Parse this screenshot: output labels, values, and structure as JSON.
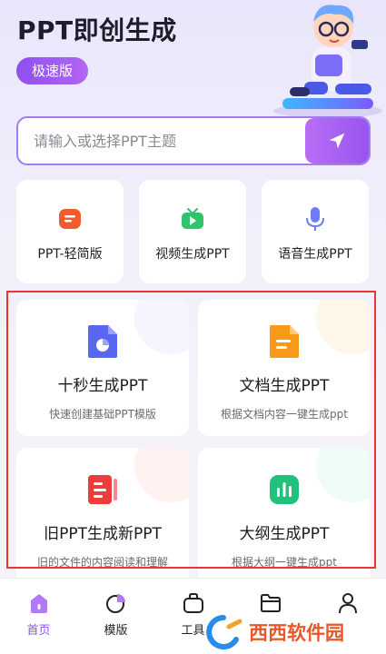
{
  "header": {
    "title": "PPT即创生成",
    "badge": "极速版"
  },
  "search": {
    "placeholder": "请输入或选择PPT主题",
    "button_icon": "send-icon"
  },
  "quick_actions": [
    {
      "label": "PPT-轻简版",
      "icon": "doc-lines-icon",
      "color": "#f05b2f"
    },
    {
      "label": "视频生成PPT",
      "icon": "tv-play-icon",
      "color": "#2fc46b"
    },
    {
      "label": "语音生成PPT",
      "icon": "microphone-icon",
      "color": "#6b7ef5"
    }
  ],
  "feature_cards": [
    {
      "title": "十秒生成PPT",
      "subtitle": "快速创建基础PPT模版",
      "icon": "pie-doc-icon",
      "color": "#5866f0"
    },
    {
      "title": "文档生成PPT",
      "subtitle": "根据文档内容一键生成ppt",
      "icon": "document-icon",
      "color": "#f79a18"
    },
    {
      "title": "旧PPT生成新PPT",
      "subtitle": "旧的文件的内容阅读和理解",
      "icon": "slides-icon",
      "color": "#ee3b3b"
    },
    {
      "title": "大纲生成PPT",
      "subtitle": "根据大纲一键生成ppt",
      "icon": "bar-chart-icon",
      "color": "#22c07a"
    }
  ],
  "tabs": [
    {
      "label": "首页",
      "icon": "home-icon",
      "active": true
    },
    {
      "label": "模版",
      "icon": "template-icon",
      "active": false
    },
    {
      "label": "工具",
      "icon": "toolbox-icon",
      "active": false
    },
    {
      "label": "",
      "icon": "folder-icon",
      "active": false
    },
    {
      "label": "",
      "icon": "user-icon",
      "active": false
    }
  ],
  "colors": {
    "accent": "#8b4ff0",
    "highlight_border": "#e8362f"
  },
  "watermark": {
    "text": "西西软件园"
  }
}
